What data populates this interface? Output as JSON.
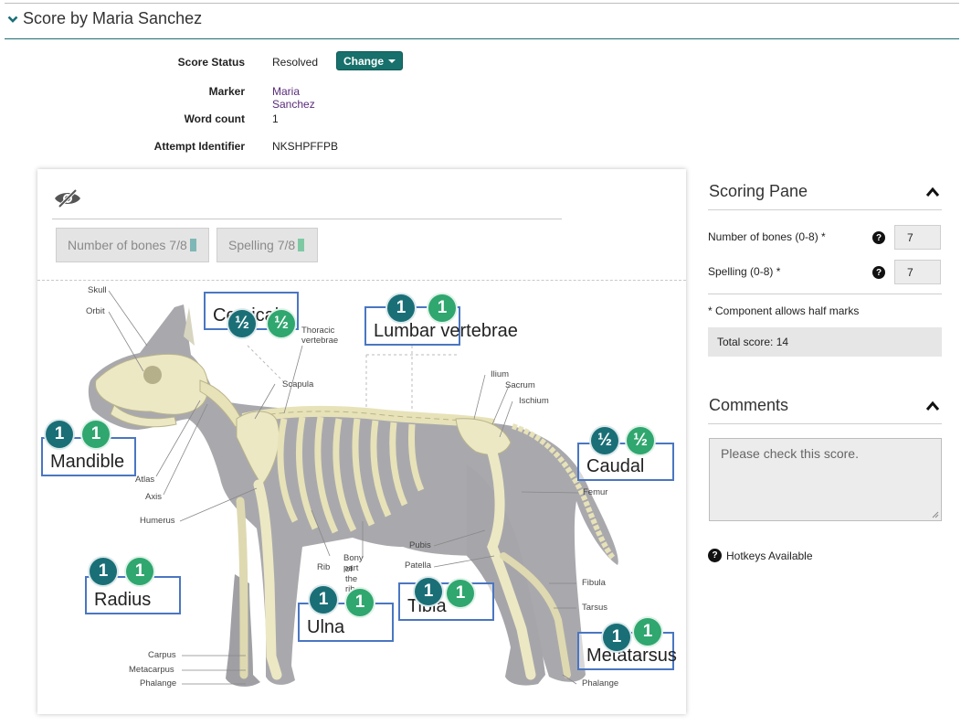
{
  "header": {
    "title": "Score by Maria Sanchez"
  },
  "meta": {
    "score_status_label": "Score Status",
    "score_status_value": "Resolved",
    "change_button": "Change",
    "marker_label": "Marker",
    "marker_value": "Maria Sanchez",
    "word_count_label": "Word count",
    "word_count_value": "1",
    "attempt_label": "Attempt Identifier",
    "attempt_value": "NKSHPFFPB"
  },
  "tabs": [
    {
      "label": "Number of bones 7/8",
      "highlight_color": "#7fb7b6"
    },
    {
      "label": "Spelling 7/8",
      "highlight_color": "#7ec9a4"
    }
  ],
  "diagram": {
    "anatomy_labels": {
      "skull": "Skull",
      "orbit": "Orbit",
      "thoracic": "Thoracic",
      "vertebrae": "vertebrae",
      "scapula": "Scapula",
      "ilium": "Ilium",
      "sacrum": "Sacrum",
      "ischium": "Ischium",
      "atlas": "Atlas",
      "axis": "Axis",
      "humerus": "Humerus",
      "femur": "Femur",
      "rib": "Rib",
      "bony_part": "Bony part",
      "of_the_rib": "of the rib",
      "pubis": "Pubis",
      "patella": "Patella",
      "fibula": "Fibula",
      "tarsus": "Tarsus",
      "carpus": "Carpus",
      "metacarpus": "Metacarpus",
      "phalange_front": "Phalange",
      "phalange_back": "Phalange"
    },
    "annotations": [
      {
        "text": "Cervical",
        "mark1": "½",
        "mark2": "½"
      },
      {
        "text": "Lumbar vertebrae",
        "mark1": "1",
        "mark2": "1"
      },
      {
        "text": "Mandible",
        "mark1": "1",
        "mark2": "1"
      },
      {
        "text": "Caudal",
        "mark1": "½",
        "mark2": "½"
      },
      {
        "text": "Radius",
        "mark1": "1",
        "mark2": "1"
      },
      {
        "text": "Ulna",
        "mark1": "1",
        "mark2": "1"
      },
      {
        "text": "Tibia",
        "mark1": "1",
        "mark2": "1"
      },
      {
        "text": "Metatarsus",
        "mark1": "1",
        "mark2": "1"
      }
    ]
  },
  "scoring_pane": {
    "title": "Scoring Pane",
    "items": [
      {
        "label": "Number of bones (0-8) *",
        "value": "7"
      },
      {
        "label": "Spelling (0-8) *",
        "value": "7"
      }
    ],
    "note": "* Component allows half marks",
    "total": "Total score: 14"
  },
  "comments": {
    "title": "Comments",
    "text": "Please check this score."
  },
  "hotkeys": {
    "label": "Hotkeys Available"
  },
  "colors": {
    "accent": "#17706b",
    "badge_dark": "#1a6f77",
    "badge_light": "#2fa76f",
    "annotation_border": "#4a76c2"
  },
  "icons": {
    "collapse": "chevron-down-icon",
    "visibility": "eye-slash-icon",
    "help": "question-circle-icon",
    "expand": "chevron-up-icon"
  }
}
